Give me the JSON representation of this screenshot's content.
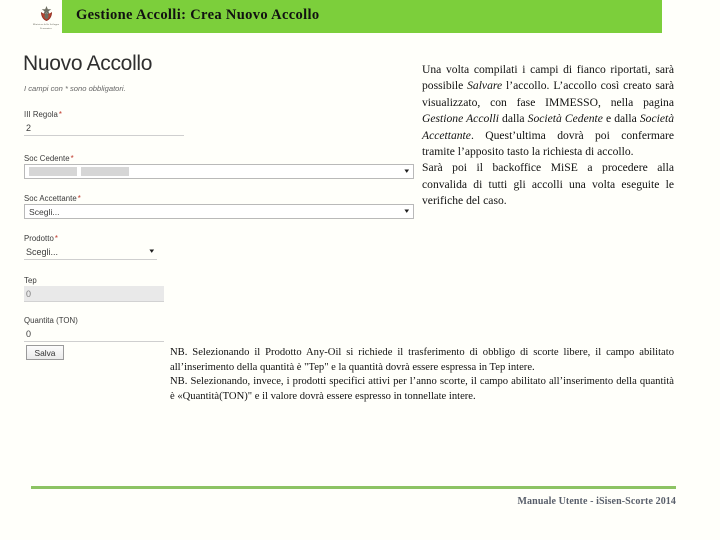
{
  "colors": {
    "header_green": "#7ccf3b",
    "footer_rule_green": "#8cc363",
    "required_asterisk_red": "#c0392b",
    "footer_text": "#595f6b",
    "page_background": "#fffffa"
  },
  "header": {
    "title": "Gestione Accolli: Crea Nuovo Accollo",
    "emblem_icon": "italian-republic-emblem-icon",
    "emblem_caption_line1": "Ministero dello Sviluppo",
    "emblem_caption_line2": "Economico"
  },
  "form": {
    "heading": "Nuovo Accollo",
    "subnote": "I campi con * sono obbligatori.",
    "required_marker": "*",
    "fields": [
      {
        "label": "III Regola",
        "required": true,
        "type": "text",
        "value": "2",
        "disabled": false
      },
      {
        "label": "Soc Cedente",
        "required": true,
        "type": "select-boxed-redacted",
        "value": "",
        "caret_icon": "chevron-down-icon",
        "disabled": false
      },
      {
        "label": "Soc Accettante",
        "required": true,
        "type": "select-boxed",
        "value": "Scegli...",
        "caret_icon": "chevron-down-icon",
        "disabled": false
      },
      {
        "label": "Prodotto",
        "required": true,
        "type": "select-underline",
        "value": "Scegli...",
        "caret_icon": "chevron-down-icon",
        "disabled": false
      },
      {
        "label": "Tep",
        "required": false,
        "type": "text",
        "value": "0",
        "disabled": true
      },
      {
        "label": "Quantita (TON)",
        "required": false,
        "type": "text",
        "value": "0",
        "disabled": false
      }
    ],
    "save_label": "Salva"
  },
  "side_text": {
    "paragraph_1_part_1": "Una volta compilati i campi di fianco riportati, sarà possibile ",
    "paragraph_1_em_1": "Salvare",
    "paragraph_1_part_2": " l’accollo. L’accollo così creato sarà visualizzato, con fase IMMESSO, nella pagina ",
    "paragraph_1_em_2": "Gestione Accolli",
    "paragraph_1_part_3": " dalla ",
    "paragraph_1_em_3": "Società Cedente",
    "paragraph_1_part_4": " e dalla ",
    "paragraph_1_em_4": "Società Accettante",
    "paragraph_1_part_5": ". Quest’ultima dovrà poi confermare tramite l’apposito tasto la richiesta di accollo.",
    "paragraph_2": "Sarà poi il backoffice MiSE a procedere alla convalida di tutti gli accolli una volta eseguite le verifiche del caso."
  },
  "notes": {
    "nb_1": "NB. Selezionando il Prodotto Any-Oil si richiede il trasferimento di obbligo di scorte libere, il campo abilitato all’inserimento della quantità è \"Tep\" e la quantità dovrà essere espressa in Tep intere.",
    "nb_2": "NB. Selezionando, invece, i prodotti specifici attivi per l’anno scorte, il campo abilitato all’inserimento della quantità è «Quantità(TON)\" e il valore dovrà essere espresso in tonnellate intere."
  },
  "footer": {
    "text": "Manuale Utente - iSisen-Scorte 2014"
  }
}
